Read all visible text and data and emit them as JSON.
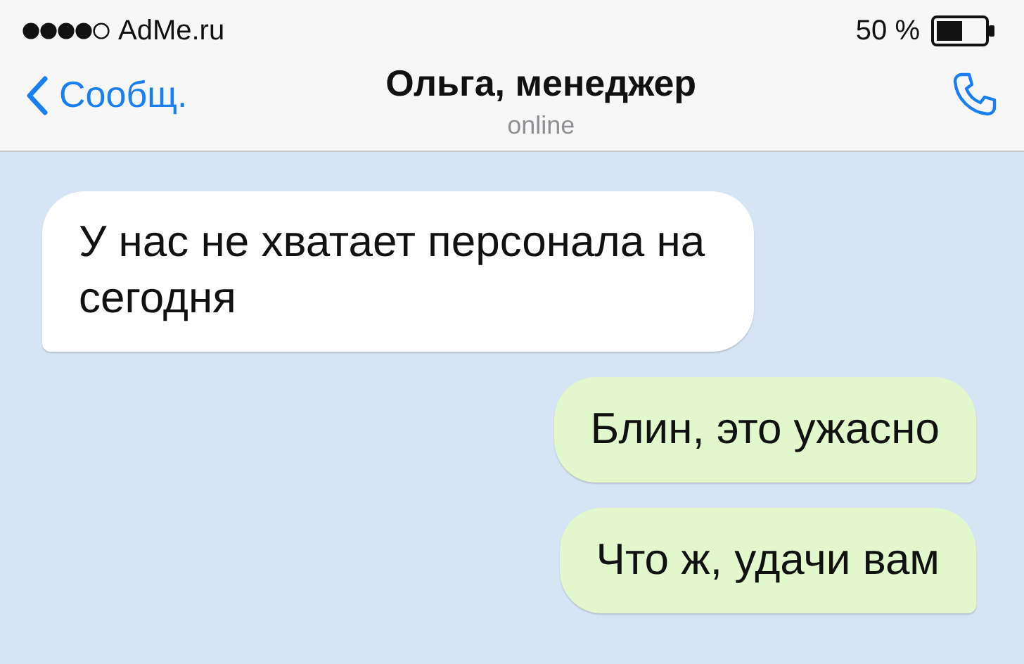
{
  "status_bar": {
    "carrier": "AdMe.ru",
    "battery": "50 %"
  },
  "header": {
    "back": "Сообщ.",
    "title": "Ольга, менеджер",
    "subtitle": "online"
  },
  "messages": [
    {
      "kind": "incoming",
      "text": "У нас не хватает персонала на сегодня"
    },
    {
      "kind": "outgoing",
      "text": "Блин, это ужасно"
    },
    {
      "kind": "outgoing",
      "text": "Что ж, удачи вам"
    }
  ]
}
